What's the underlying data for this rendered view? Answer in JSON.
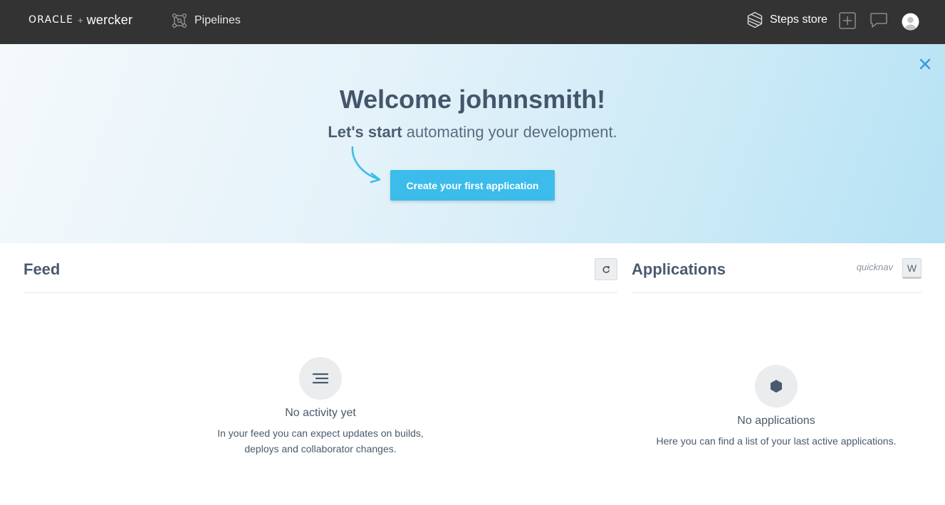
{
  "nav": {
    "logo_oracle": "ORACLE",
    "logo_plus": "+",
    "logo_wercker": "wercker",
    "pipelines_label": "Pipelines",
    "steps_store_label": "Steps store"
  },
  "hero": {
    "title": "Welcome johnnsmith!",
    "subtitle_strong": "Let's start",
    "subtitle_rest": " automating your development.",
    "cta_label": "Create your first application"
  },
  "feed": {
    "title": "Feed",
    "empty_title": "No activity yet",
    "empty_line1": "In your feed you can expect updates on builds,",
    "empty_line2": "deploys and collaborator changes."
  },
  "applications": {
    "title": "Applications",
    "quicknav_label": "quicknav",
    "quicknav_key": "W",
    "empty_title": "No applications",
    "empty_text": "Here you can find a list of your last active applications."
  },
  "colors": {
    "topbar": "#333333",
    "accent": "#3bbcea",
    "text": "#4a5a6e"
  },
  "icons": [
    "pipelines-icon",
    "steps-store-icon",
    "add-icon",
    "chat-icon",
    "avatar",
    "close-icon",
    "refresh-icon",
    "feed-list-icon",
    "hexagon-icon"
  ]
}
